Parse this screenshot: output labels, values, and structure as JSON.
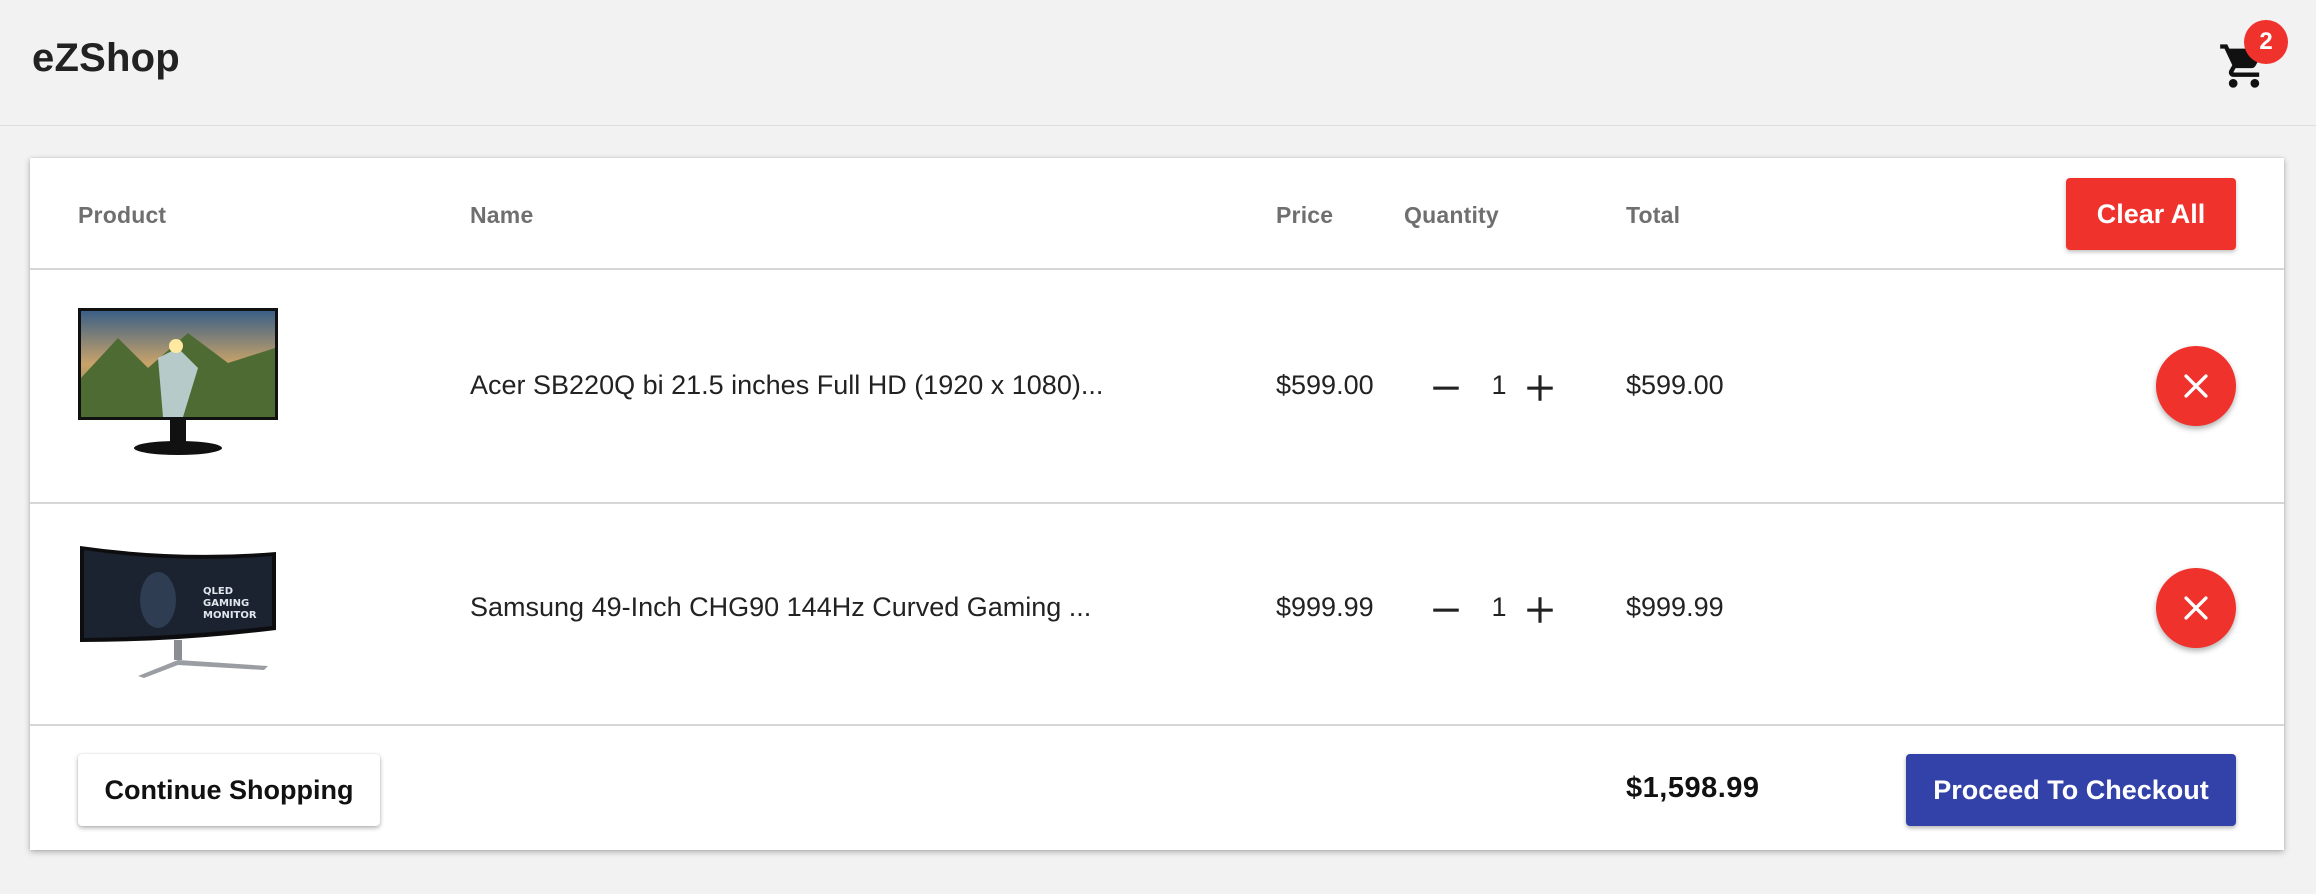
{
  "app": {
    "brand": "eZShop"
  },
  "cart": {
    "icon": "shopping-cart-icon",
    "badge_count": "2"
  },
  "table": {
    "headers": {
      "product": "Product",
      "name": "Name",
      "price": "Price",
      "quantity": "Quantity",
      "total": "Total"
    },
    "clear_all_label": "Clear All",
    "items": [
      {
        "name": "Acer SB220Q bi 21.5 inches Full HD (1920 x 1080)...",
        "price": "$599.00",
        "quantity": "1",
        "total": "$599.00"
      },
      {
        "name": "Samsung 49-Inch CHG90 144Hz Curved Gaming ...",
        "price": "$999.99",
        "quantity": "1",
        "total": "$999.99"
      }
    ]
  },
  "footer": {
    "continue_label": "Continue Shopping",
    "grand_total": "$1,598.99",
    "checkout_label": "Proceed To Checkout"
  },
  "colors": {
    "danger": "#f0322d",
    "primary": "#3342a8",
    "background": "#f2f2f2"
  }
}
